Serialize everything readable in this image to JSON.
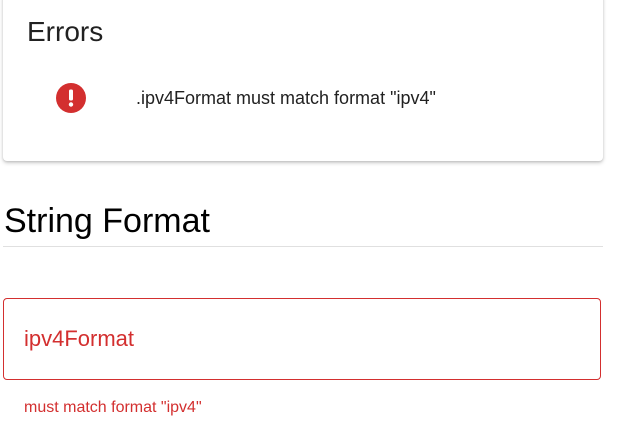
{
  "errors_panel": {
    "title": "Errors",
    "items": [
      {
        "icon": "error-icon",
        "message": ".ipv4Format must match format \"ipv4\""
      }
    ]
  },
  "section": {
    "title": "String Format"
  },
  "field": {
    "label": "ipv4Format",
    "value": "",
    "helper_text": "must match format \"ipv4\""
  },
  "colors": {
    "error": "#d32f2f",
    "text": "#212121",
    "divider": "#e0e0e0"
  }
}
